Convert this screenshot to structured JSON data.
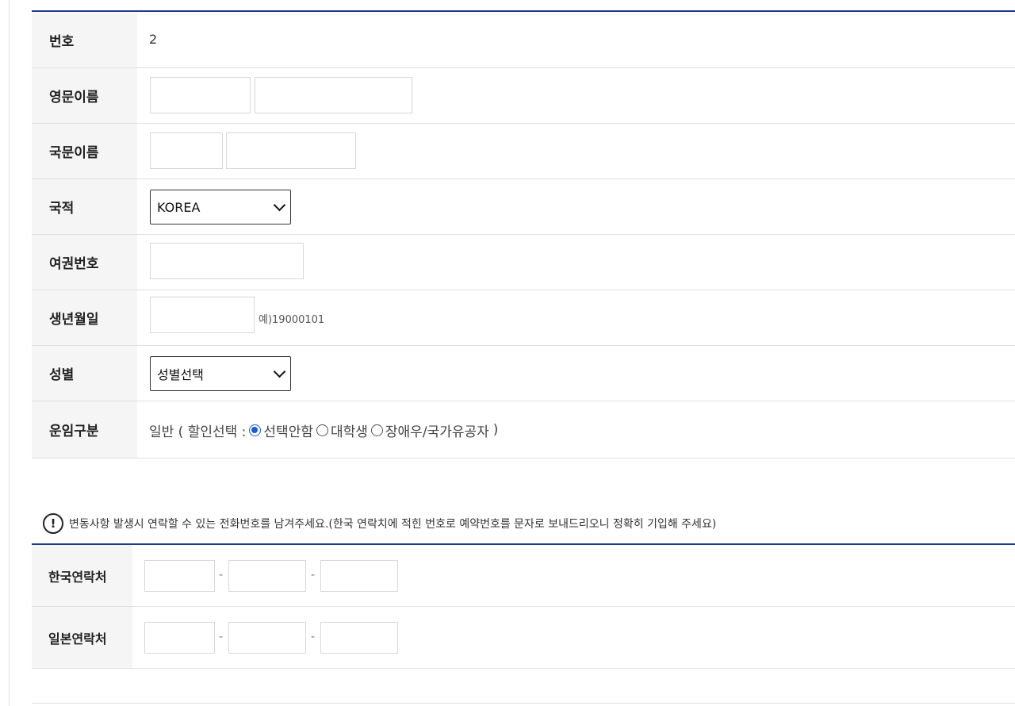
{
  "form": {
    "number": {
      "label": "번호",
      "value": "2"
    },
    "english_name": {
      "label": "영문이름",
      "surname_value": "",
      "given_value": ""
    },
    "korean_name": {
      "label": "국문이름",
      "surname_value": "",
      "given_value": ""
    },
    "nationality": {
      "label": "국적",
      "selected": "KOREA"
    },
    "passport": {
      "label": "여권번호",
      "value": ""
    },
    "birthdate": {
      "label": "생년월일",
      "value": "",
      "hint": "예)19000101"
    },
    "gender": {
      "label": "성별",
      "selected": "성별선택"
    },
    "fare": {
      "label": "운임구분",
      "prefix": "일반 ( 할인선택 :",
      "options": [
        "선택안함",
        "대학생",
        "장애우/국가유공자"
      ],
      "selected_index": 0,
      "suffix": ")"
    }
  },
  "notice": {
    "icon": "exclamation-circle-icon",
    "text": "변동사항 발생시 연락할 수 있는 전화번호를 남겨주세요.(한국 연락치에 적힌 번호로 예약번호를 문자로 보내드리오니 정확히 기입해 주세요)"
  },
  "contacts": {
    "korea": {
      "label": "한국연락처",
      "parts": [
        "",
        "",
        ""
      ]
    },
    "japan": {
      "label": "일본연락처",
      "parts": [
        "",
        "",
        ""
      ]
    },
    "separator": "-"
  }
}
